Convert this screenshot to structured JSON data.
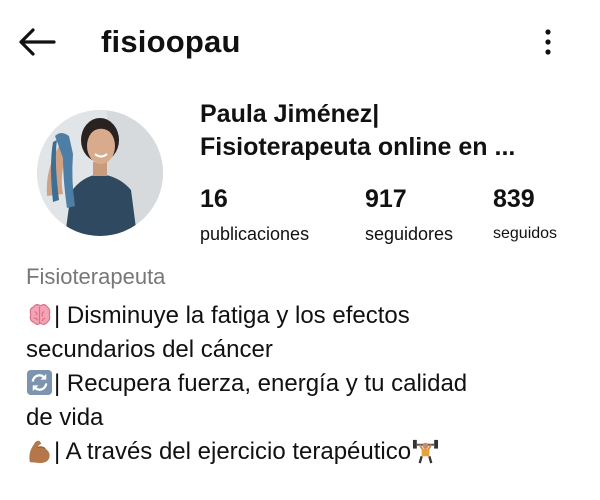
{
  "header": {
    "username": "fisioopau",
    "back_icon": "arrow-left-icon",
    "more_icon": "more-vertical-icon"
  },
  "profile": {
    "name_line1": "Paula Jiménez|",
    "name_line2": "Fisioterapeuta online en ...",
    "stats": {
      "posts_count": "16",
      "posts_label": "publicaciones",
      "followers_count": "917",
      "followers_label": "seguidores",
      "following_count": "839",
      "following_label": "seguidos"
    },
    "category": "Fisioterapeuta",
    "bio": [
      {
        "emoji": "brain-icon",
        "text": "| Disminuye la fatiga y los efectos"
      },
      {
        "text": "secundarios del cáncer"
      },
      {
        "emoji": "refresh-icon",
        "text": "| Recupera fuerza, energía y tu calidad"
      },
      {
        "text": "de vida"
      },
      {
        "emoji": "flexed-biceps-icon",
        "text": "| A través del ejercicio terapéutico",
        "trailing_emoji": "weightlifter-icon"
      }
    ]
  },
  "colors": {
    "text_primary": "#111111",
    "text_secondary": "#777777",
    "background": "#ffffff"
  }
}
